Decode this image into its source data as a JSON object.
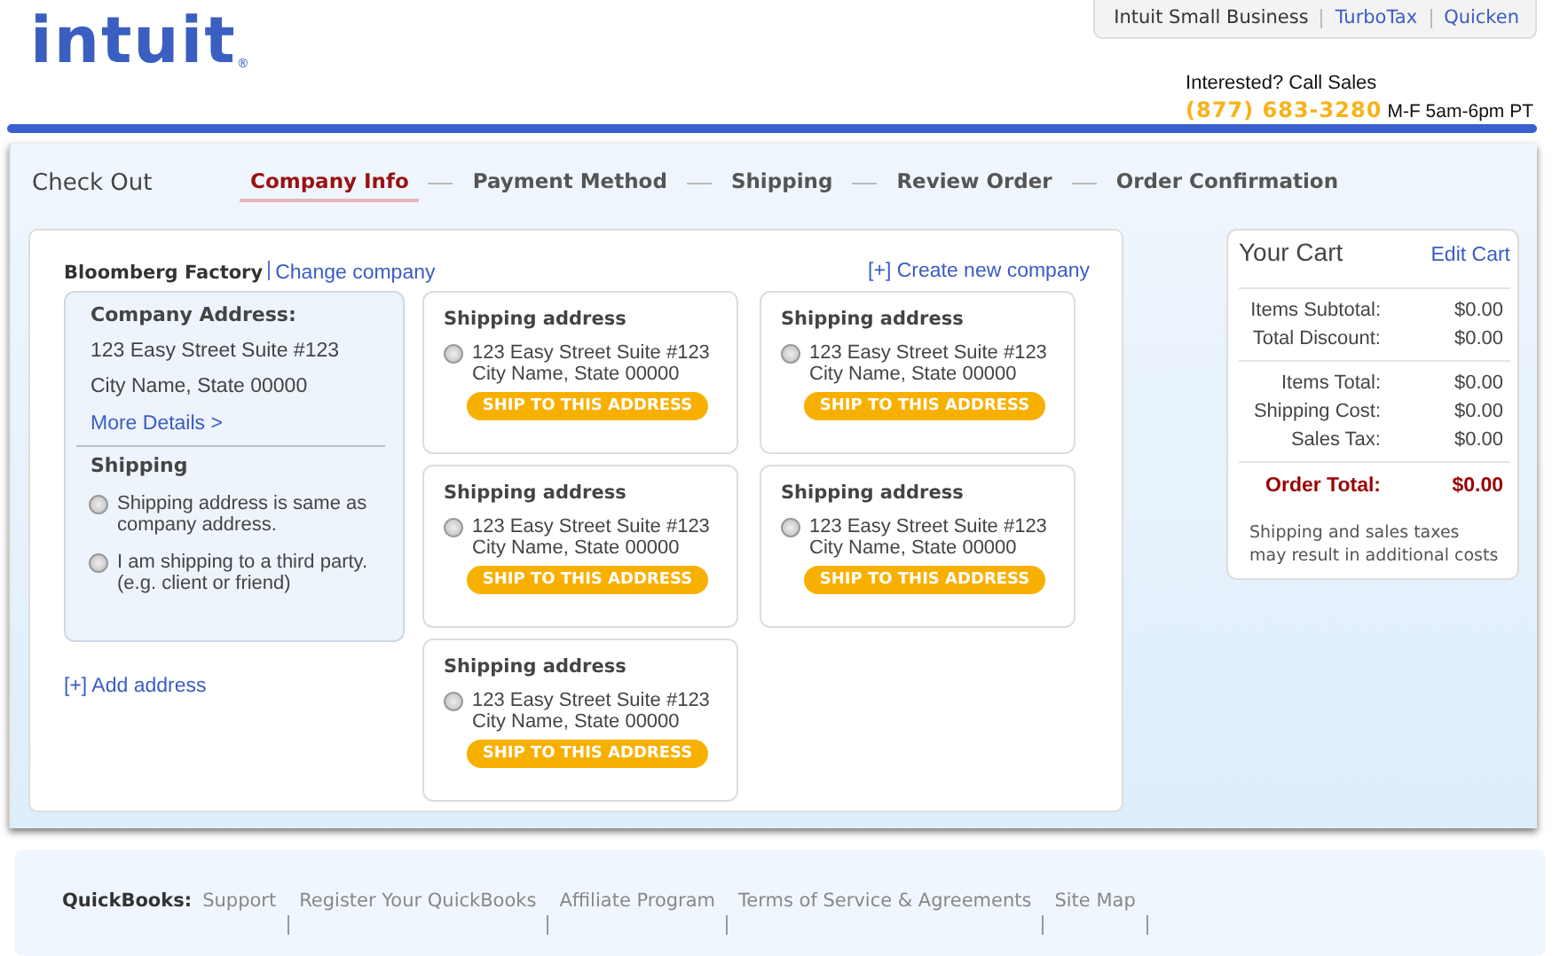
{
  "logo": {
    "text": "intuit",
    "mark": "®"
  },
  "top_links": [
    {
      "label": "Intuit Small Business",
      "kind": "plain"
    },
    {
      "label": "TurboTax",
      "kind": "link"
    },
    {
      "label": "Quicken",
      "kind": "link"
    }
  ],
  "sales": {
    "text": "Interested? Call Sales",
    "phone": "(877) 683-3280",
    "hours": "M-F 5am-6pm PT"
  },
  "checkout": {
    "title": "Check Out",
    "steps": [
      {
        "label": "Company Info",
        "selected": true
      },
      {
        "label": "Payment Method",
        "selected": false
      },
      {
        "label": "Shipping",
        "selected": false
      },
      {
        "label": "Review Order",
        "selected": false
      },
      {
        "label": "Order Confirmation",
        "selected": false
      }
    ]
  },
  "company": {
    "name": "Bloomberg Factory",
    "change_link": "Change company",
    "create_link": "[+] Create new company",
    "address_heading": "Company Address:",
    "address_lines": [
      "123 Easy Street Suite #123",
      "City Name, State 00000"
    ],
    "details_link": "More Details >",
    "shipping_heading": "Shipping",
    "shipping_options": [
      {
        "label": "Shipping address is same as company address.",
        "checked": false
      },
      {
        "label": "I am shipping to a third party. (e.g. client or friend)",
        "checked": false
      }
    ],
    "add_link": "[+] Add address"
  },
  "addresses": [
    {
      "heading": "Shipping address",
      "line1": "123 Easy Street Suite #123",
      "line2": "City Name, State 00000",
      "checked": false,
      "button": "SHIP TO THIS ADDRESS"
    },
    {
      "heading": "Shipping address",
      "line1": "123 Easy Street Suite #123",
      "line2": "City Name, State 00000",
      "checked": false,
      "button": "SHIP TO THIS ADDRESS"
    },
    {
      "heading": "Shipping address",
      "line1": "123 Easy Street Suite #123",
      "line2": "City Name, State 00000",
      "checked": false,
      "button": "SHIP TO THIS ADDRESS"
    },
    {
      "heading": "Shipping address",
      "line1": "123 Easy Street Suite #123",
      "line2": "City Name, State 00000",
      "checked": false,
      "button": "SHIP TO THIS ADDRESS"
    },
    {
      "heading": "Shipping address",
      "line1": "123 Easy Street Suite #123",
      "line2": "City Name, State 00000",
      "checked": false,
      "button": "SHIP TO THIS ADDRESS"
    }
  ],
  "cart": {
    "title": "Your Cart",
    "edit_link": "Edit Cart",
    "groups": [
      [
        {
          "label": "Items Subtotal:",
          "value": "$0.00"
        },
        {
          "label": "Total Discount:",
          "value": "$0.00"
        }
      ],
      [
        {
          "label": "Items Total:",
          "value": "$0.00"
        },
        {
          "label": "Shipping Cost:",
          "value": "$0.00"
        },
        {
          "label": "Sales Tax:",
          "value": "$0.00"
        }
      ]
    ],
    "total": {
      "label": "Order Total:",
      "value": "$0.00"
    },
    "note": "Shipping and sales taxes may result in additional costs"
  },
  "footer": {
    "brand": "QuickBooks:",
    "links": [
      "Support",
      "Register Your QuickBooks",
      "Affiliate Program",
      "Terms of Service & Agreements",
      "Site Map"
    ]
  }
}
